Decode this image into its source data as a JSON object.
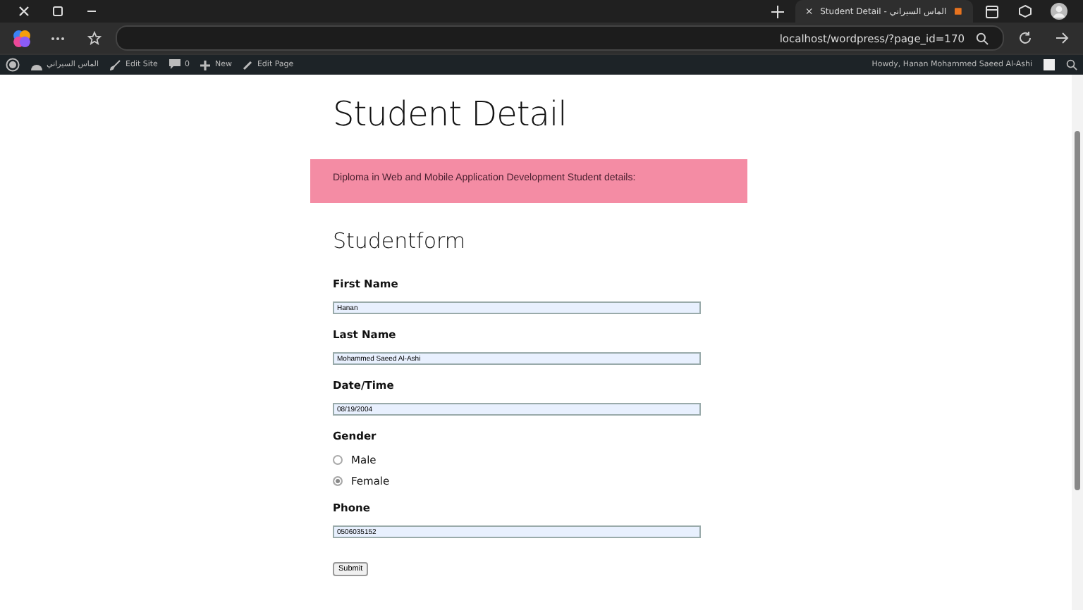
{
  "browser": {
    "tab_title": "Student Detail - الماس السيراني",
    "address": "localhost/wordpress/?page_id=170"
  },
  "admin_bar": {
    "items": [
      {
        "kind": "site",
        "label": "الماس السيراني"
      },
      {
        "kind": "edit-site",
        "label": "Edit Site"
      },
      {
        "kind": "comments",
        "label": "0"
      },
      {
        "kind": "new",
        "label": "New"
      },
      {
        "kind": "edit-page",
        "label": "Edit Page"
      }
    ],
    "greeting": "Howdy, Hanan Mohammed Saeed Al-Ashi"
  },
  "page": {
    "title": "Student Detail",
    "notice": "Diploma in Web and Mobile Application Development Student details:",
    "form_title": "Studentform",
    "fields": [
      {
        "kind": "text",
        "label": "First Name",
        "value": "Hanan"
      },
      {
        "kind": "text",
        "label": "Last Name",
        "value": "Mohammed Saeed Al-Ashi"
      },
      {
        "kind": "text",
        "label": "Date/Time",
        "value": "08/19/2004"
      },
      {
        "kind": "radio",
        "label": "Gender",
        "options": [
          {
            "label": "Male",
            "selected": false
          },
          {
            "label": "Female",
            "selected": true
          }
        ]
      },
      {
        "kind": "text",
        "label": "Phone",
        "value": "0506035152"
      }
    ],
    "submit": "Submit"
  }
}
